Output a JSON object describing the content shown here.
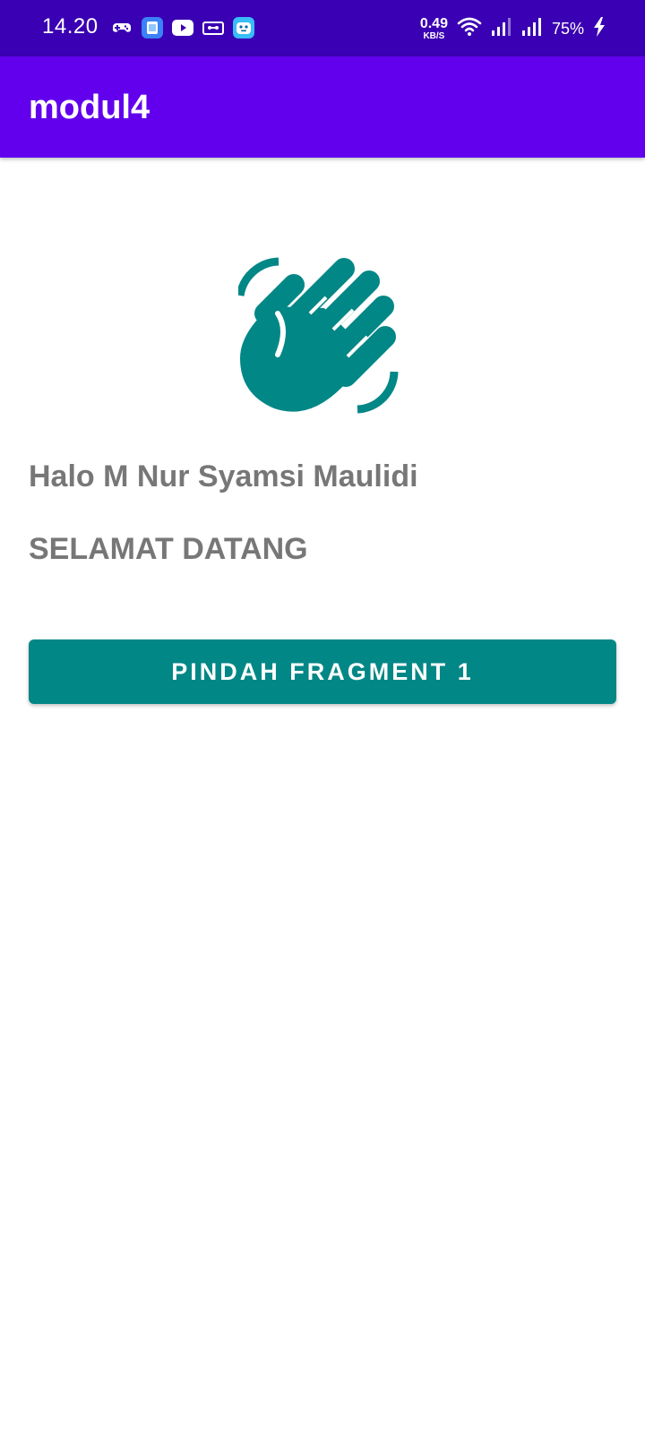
{
  "status_bar": {
    "time": "14.20",
    "net_speed_value": "0.49",
    "net_speed_unit": "KB/S",
    "battery": "75%",
    "icons": [
      "gamepad-icon",
      "app-badge-icon",
      "youtube-icon",
      "cassette-icon",
      "bot-icon",
      "wifi-icon",
      "signal-icon",
      "signal-icon",
      "charging-icon"
    ]
  },
  "app_bar": {
    "title": "modul4"
  },
  "content": {
    "icon": "waving-hand-icon",
    "greeting": "Halo M Nur Syamsi Maulidi",
    "welcome": "SELAMAT DATANG",
    "button_label": "PINDAH FRAGMENT 1"
  },
  "colors": {
    "status_bar": "#3a00b3",
    "primary": "#6200ee",
    "accent": "#018786",
    "text_gray": "#777777"
  }
}
